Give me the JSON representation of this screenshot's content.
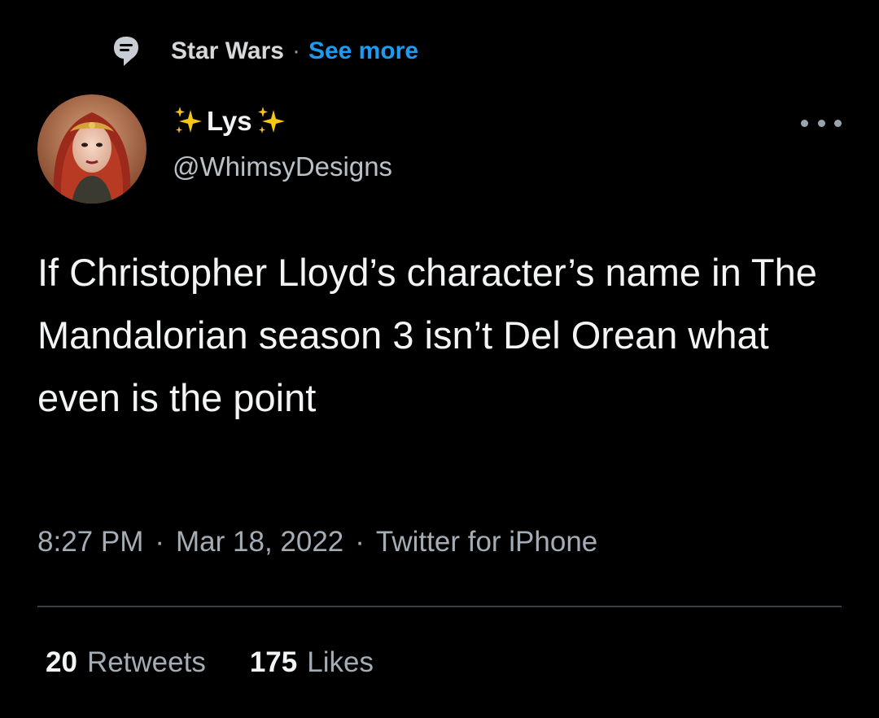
{
  "topic": {
    "label": "Star Wars",
    "separator": "·",
    "see_more": "See more",
    "icon": "topic-icon"
  },
  "author": {
    "display_name": "Lys",
    "handle": "@WhimsyDesigns",
    "avatar": "avatar-photo",
    "name_decoration": "sparkles-emoji"
  },
  "tweet": {
    "text": "If Christopher Lloyd’s character’s name in The Mandalorian season 3 isn’t Del Orean what even is the point"
  },
  "meta": {
    "time": "8:27 PM",
    "separator": "·",
    "date": "Mar 18, 2022",
    "source": "Twitter for iPhone"
  },
  "stats": {
    "retweets_count": "20",
    "retweets_label": "Retweets",
    "likes_count": "175",
    "likes_label": "Likes"
  },
  "colors": {
    "background": "#000000",
    "accent": "#1d9bf0",
    "primary_text": "#f2f4f5",
    "secondary_text": "#a4adb5",
    "divider": "#3a3f44"
  }
}
